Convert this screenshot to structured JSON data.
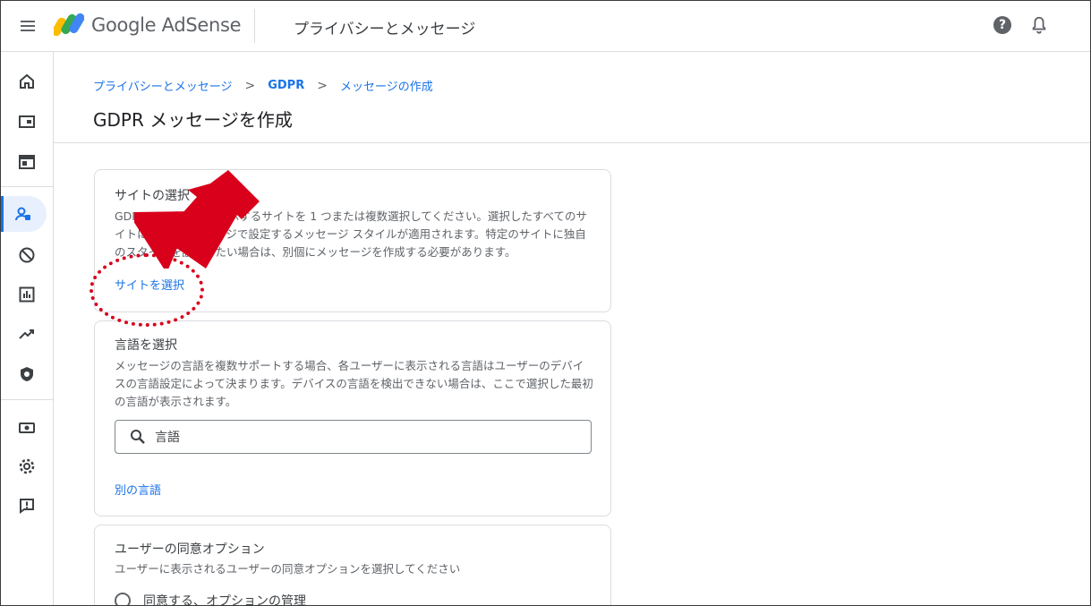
{
  "app": {
    "brand": "Google AdSense",
    "section": "プライバシーとメッセージ",
    "help_glyph": "?",
    "colors": {
      "accent": "#1a73e8",
      "annotation": "#d9001b"
    }
  },
  "sidebar": {
    "items": [
      {
        "icon": "home-icon"
      },
      {
        "icon": "ads-icon"
      },
      {
        "icon": "sites-icon"
      },
      {
        "icon": "privacy-messaging-icon",
        "active": true
      },
      {
        "icon": "blocking-controls-icon"
      },
      {
        "icon": "reports-icon"
      },
      {
        "icon": "optimization-icon"
      },
      {
        "icon": "policy-center-icon"
      },
      {
        "icon": "payments-icon"
      },
      {
        "icon": "settings-icon"
      },
      {
        "icon": "feedback-icon"
      }
    ]
  },
  "breadcrumb": {
    "items": [
      "プライバシーとメッセージ",
      "GDPR",
      "メッセージの作成"
    ],
    "separator": ">"
  },
  "page_title": "GDPR メッセージを作成",
  "sites_card": {
    "title": "サイトの選択",
    "description": "GDPR メッセージを表示するサイトを 1 つまたは複数選択してください。選択したすべてのサイトに、このメッセージで設定するメッセージ スタイルが適用されます。特定のサイトに独自のスタイルを設定したい場合は、別個にメッセージを作成する必要があります。",
    "link": "サイトを選択"
  },
  "language_card": {
    "title": "言語を選択",
    "description": "メッセージの言語を複数サポートする場合、各ユーザーに表示される言語はユーザーのデバイスの言語設定によって決まります。デバイスの言語を検出できない場合は、ここで選択した最初の言語が表示されます。",
    "search_placeholder": "言語",
    "link": "別の言語"
  },
  "consent_card": {
    "title": "ユーザーの同意オプション",
    "description": "ユーザーに表示されるユーザーの同意オプションを選択してください",
    "options": [
      "同意する、オプションの管理"
    ]
  }
}
